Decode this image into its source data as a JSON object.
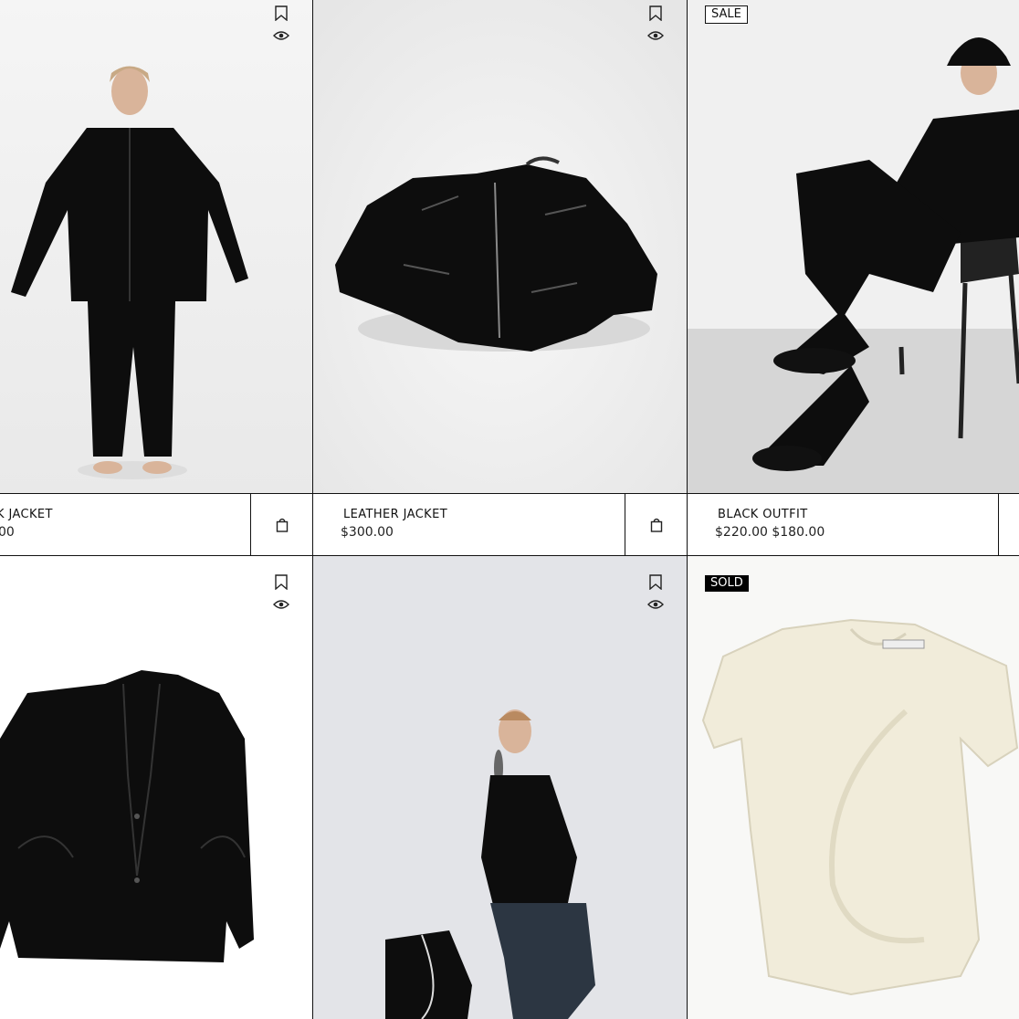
{
  "products": [
    {
      "name": "K JACKET",
      "price": "00",
      "has_sale_badge": false
    },
    {
      "name": "LEATHER JACKET",
      "price": "$300.00",
      "has_sale_badge": false
    },
    {
      "name": "BLACK OUTFIT",
      "price": "$220.00 $180.00",
      "badge": "SALE"
    },
    {
      "name": "",
      "price": ""
    },
    {
      "name": "",
      "price": ""
    },
    {
      "name": "",
      "price": "",
      "badge": "SOLD"
    }
  ],
  "icons": {
    "wishlist": "bookmark-icon",
    "quick_view": "eye-icon",
    "cart": "shopping-bag-icon"
  },
  "colors": {
    "border": "#111111",
    "text": "#111111",
    "sold_badge_bg": "#000000",
    "background": "#ffffff"
  }
}
